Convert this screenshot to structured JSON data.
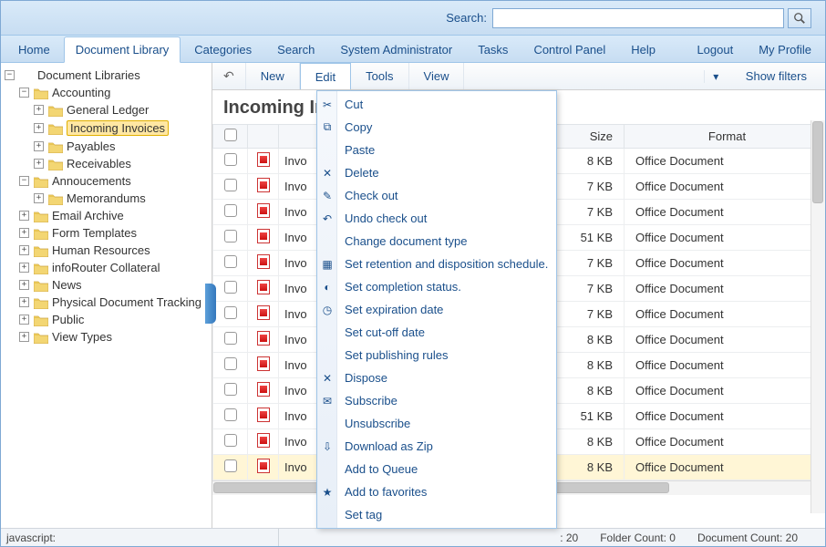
{
  "search": {
    "label": "Search:",
    "placeholder": ""
  },
  "nav": {
    "left": [
      "Home",
      "Document Library",
      "Categories",
      "Search",
      "System Administrator",
      "Tasks",
      "Control Panel",
      "Help"
    ],
    "right": [
      "Logout",
      "My Profile"
    ],
    "active_index": 1
  },
  "tree": {
    "root": "Document Libraries",
    "nodes": [
      {
        "label": "Accounting",
        "expanded": true,
        "indent": 1,
        "children": [
          {
            "label": "General Ledger",
            "indent": 2,
            "hasChildren": true
          },
          {
            "label": "Incoming Invoices",
            "indent": 2,
            "selected": true,
            "hasChildren": true
          },
          {
            "label": "Payables",
            "indent": 2,
            "hasChildren": true
          },
          {
            "label": "Receivables",
            "indent": 2,
            "hasChildren": true
          }
        ]
      },
      {
        "label": "Annoucements",
        "expanded": true,
        "indent": 1,
        "children": [
          {
            "label": "Memorandums",
            "indent": 2,
            "hasChildren": true
          }
        ]
      },
      {
        "label": "Email Archive",
        "indent": 1,
        "hasChildren": true
      },
      {
        "label": "Form Templates",
        "indent": 1,
        "hasChildren": true
      },
      {
        "label": "Human Resources",
        "indent": 1,
        "hasChildren": true
      },
      {
        "label": "infoRouter Collateral",
        "indent": 1,
        "hasChildren": true
      },
      {
        "label": "News",
        "indent": 1,
        "hasChildren": true
      },
      {
        "label": "Physical Document Tracking",
        "indent": 1,
        "hasChildren": true
      },
      {
        "label": "Public",
        "indent": 1,
        "hasChildren": true
      },
      {
        "label": "View Types",
        "indent": 1,
        "hasChildren": true
      }
    ]
  },
  "toolbar": {
    "back": "←",
    "items": [
      "New",
      "Edit",
      "Tools",
      "View"
    ],
    "show_filters": "Show filters",
    "open_index": 1
  },
  "heading": "Incoming Invoices",
  "table": {
    "headers": {
      "size": "Size",
      "format": "Format"
    },
    "rows": [
      {
        "name": "Invo",
        "size": "8 KB",
        "format": "Office Document"
      },
      {
        "name": "Invo",
        "size": "7 KB",
        "format": "Office Document"
      },
      {
        "name": "Invo",
        "size": "7 KB",
        "format": "Office Document"
      },
      {
        "name": "Invo",
        "size": "51 KB",
        "format": "Office Document"
      },
      {
        "name": "Invo",
        "size": "7 KB",
        "format": "Office Document"
      },
      {
        "name": "Invo",
        "size": "7 KB",
        "format": "Office Document"
      },
      {
        "name": "Invo",
        "size": "7 KB",
        "format": "Office Document"
      },
      {
        "name": "Invo",
        "size": "8 KB",
        "format": "Office Document"
      },
      {
        "name": "Invo",
        "size": "8 KB",
        "format": "Office Document"
      },
      {
        "name": "Invo",
        "size": "8 KB",
        "format": "Office Document"
      },
      {
        "name": "Invo",
        "size": "51 KB",
        "format": "Office Document"
      },
      {
        "name": "Invo",
        "size": "8 KB",
        "format": "Office Document"
      },
      {
        "name": "Invo",
        "size": "8 KB",
        "format": "Office Document",
        "highlight": true
      }
    ]
  },
  "edit_menu": [
    {
      "label": "Cut",
      "icon": "scissors"
    },
    {
      "label": "Copy",
      "icon": "copy"
    },
    {
      "label": "Paste",
      "icon": ""
    },
    {
      "label": "Delete",
      "icon": "x"
    },
    {
      "label": "Check out",
      "icon": "checkout"
    },
    {
      "label": "Undo check out",
      "icon": "undo"
    },
    {
      "label": "Change document type",
      "icon": ""
    },
    {
      "label": "Set retention and disposition schedule.",
      "icon": "calendar"
    },
    {
      "label": "Set completion status.",
      "icon": "status"
    },
    {
      "label": "Set expiration date",
      "icon": "clock"
    },
    {
      "label": "Set cut-off date",
      "icon": ""
    },
    {
      "label": "Set publishing rules",
      "icon": ""
    },
    {
      "label": "Dispose",
      "icon": "x"
    },
    {
      "label": "Subscribe",
      "icon": "mail"
    },
    {
      "label": "Unsubscribe",
      "icon": ""
    },
    {
      "label": "Download as Zip",
      "icon": "zip"
    },
    {
      "label": "Add to Queue",
      "icon": ""
    },
    {
      "label": "Add to favorites",
      "icon": "fav"
    },
    {
      "label": "Set tag",
      "icon": ""
    }
  ],
  "status": {
    "left": "javascript:",
    "counts": {
      "r1_label": ": 20",
      "folder": "Folder Count: 0",
      "doc": "Document Count: 20"
    }
  }
}
